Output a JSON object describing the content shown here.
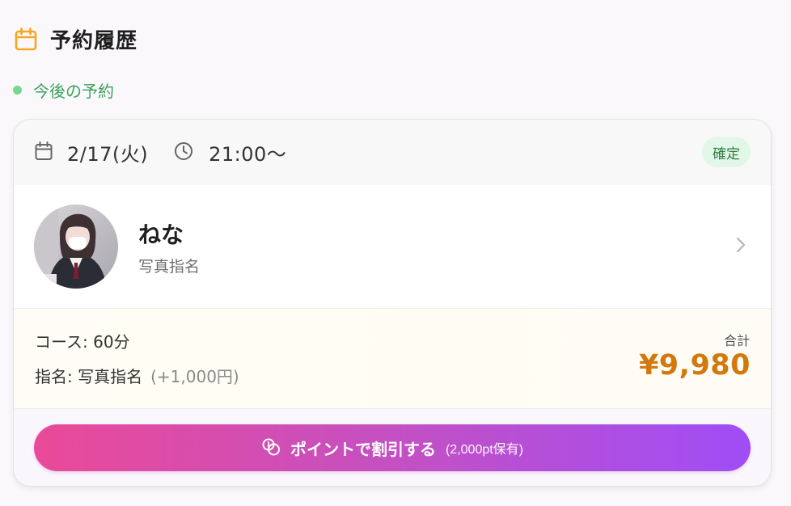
{
  "section": {
    "title": "予約履歴",
    "icon": "calendar-icon",
    "accent": "#f5a623"
  },
  "upcoming": {
    "label": "今後の予約",
    "dot_color": "#78d88c"
  },
  "reservation": {
    "date": "2/17(火)",
    "time": "21:00〜",
    "status": "確定",
    "cast": {
      "name": "ねな",
      "nomination_type": "写真指名",
      "avatar_icon": "avatar"
    },
    "course": "コース: 60分",
    "nomination": "指名: 写真指名",
    "nomination_fee": "(+1,000円)",
    "total_label": "合計",
    "total": "¥9,980",
    "total_color": "#d2790e"
  },
  "action": {
    "label": "ポイントで割引する",
    "points": "(2,000pt保有)",
    "icon": "coins-icon",
    "gradient": [
      "#ea4a98",
      "#9f4df7"
    ]
  }
}
